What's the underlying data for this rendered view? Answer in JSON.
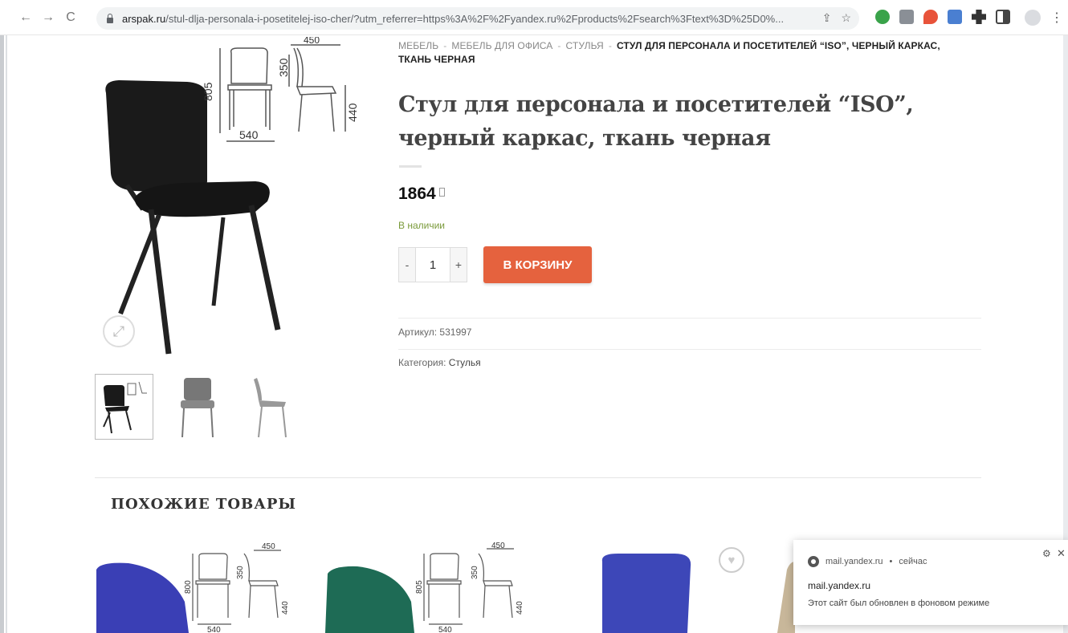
{
  "browser": {
    "url_host": "arspak.ru",
    "url_rest": "/stul-dlja-personala-i-posetitelej-iso-cher/?utm_referrer=https%3A%2F%2Fyandex.ru%2Fproducts%2Fsearch%3Ftext%3D%25D0%...",
    "back_icon": "←",
    "forward_icon": "→",
    "reload_icon": "C",
    "share_icon": "⇪",
    "star_icon": "☆",
    "menu_icon": "⋮"
  },
  "breadcrumb": {
    "items": [
      "Мебель",
      "Мебель для офиса",
      "Стулья"
    ],
    "separator": "-",
    "current": "Стул для персонала и посетителей “ISO”, черный каркас, ткань черная"
  },
  "product": {
    "title": "Стул для персонала и посетителей “ISO”, черный каркас, ткань черная",
    "price": "1864",
    "stock": "В наличии",
    "quantity": "1",
    "qty_minus": "-",
    "qty_plus": "+",
    "add_to_cart": "В корзину",
    "sku_label": "Артикул:",
    "sku_value": "531997",
    "category_label": "Категория:",
    "category_value": "Стулья"
  },
  "diagram": {
    "height_total": "805",
    "seat_width": "540",
    "seat_height": "350",
    "depth": "440",
    "top_width": "450"
  },
  "related": {
    "title": "Похожие товары",
    "items": [
      {
        "color": "#3a3fb5",
        "dims": [
          "450",
          "800",
          "350",
          "440",
          "540"
        ]
      },
      {
        "color": "#1e6b55",
        "dims": [
          "450",
          "805",
          "350",
          "440",
          "540"
        ]
      },
      {
        "color": "#3d47b8",
        "dims": []
      },
      {
        "color": "#c8b79a",
        "dims": []
      }
    ]
  },
  "notification": {
    "source": "mail.yandex.ru",
    "dot": "•",
    "time": "сейчас",
    "title": "mail.yandex.ru",
    "body": "Этот сайт был обновлен в фоновом режиме"
  },
  "colors": {
    "accent": "#e5623e",
    "stock": "#7a9a3a"
  }
}
